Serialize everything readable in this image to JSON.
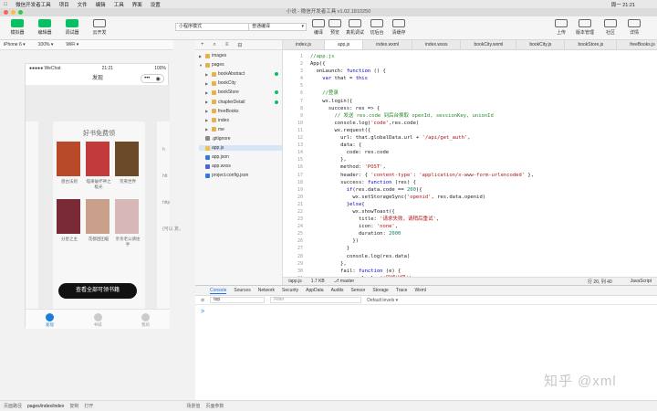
{
  "menubar": {
    "items": [
      "微信开发者工具",
      "项目",
      "文件",
      "编辑",
      "工具",
      "界面",
      "设置"
    ],
    "right": [
      "周一 21:21"
    ]
  },
  "window_title": "小说 - 微信开发者工具 v1.02.1810250",
  "toolbar": {
    "buttons": {
      "simulator": "模拟器",
      "editor": "编辑器",
      "debugger": "调试器",
      "cloud": "云开发",
      "compile": "编译",
      "preview": "预览",
      "remote_debug": "真机调试",
      "background": "切后台",
      "clear_cache": "清缓存",
      "upload": "上传",
      "version": "版本管理",
      "community": "社区",
      "details": "详情"
    },
    "mode_select": "小程序模式",
    "compile_select": "普通编译"
  },
  "simbar": {
    "device": "iPhone 6",
    "zoom": "100%",
    "network": "WiFi"
  },
  "phone": {
    "carrier": "●●●●● WeChat",
    "time": "21:21",
    "battery": "100%",
    "nav_title": "发现",
    "card_title": "好书免费领",
    "books": [
      {
        "name": "盘古法则",
        "color": "#b84a2a"
      },
      {
        "name": "喵果破坏神之极光",
        "color": "#c23a3a"
      },
      {
        "name": "荒夷世界",
        "color": "#6b4a2a"
      },
      {
        "name": "分星之主",
        "color": "#7a2a34"
      },
      {
        "name": "花都团团临",
        "color": "#c9a08a"
      },
      {
        "name": "亲亲老公请往手",
        "color": "#d7b7b7"
      }
    ],
    "cta": "查看全部可领书籍",
    "tabs": [
      "发现",
      "书城",
      "我的"
    ],
    "side_hints": [
      "h",
      "htt",
      "http",
      "(可以 复。"
    ]
  },
  "status": {
    "label": "页面路径",
    "path": "pages/index/index",
    "copy": "复制",
    "open": "打开",
    "scene": "场景值",
    "params": "页面参数"
  },
  "tree": {
    "items": [
      {
        "name": "images",
        "type": "folder",
        "depth": 0,
        "open": false
      },
      {
        "name": "pages",
        "type": "folder",
        "depth": 0,
        "open": true
      },
      {
        "name": "bookAbstract",
        "type": "folder",
        "depth": 1,
        "open": false,
        "dot": true
      },
      {
        "name": "bookCity",
        "type": "folder",
        "depth": 1,
        "open": false
      },
      {
        "name": "bookStore",
        "type": "folder",
        "depth": 1,
        "open": false,
        "dot": true
      },
      {
        "name": "chapterDetail",
        "type": "folder",
        "depth": 1,
        "open": false,
        "dot": true
      },
      {
        "name": "freeBooks",
        "type": "folder",
        "depth": 1,
        "open": false
      },
      {
        "name": "index",
        "type": "folder",
        "depth": 1,
        "open": false
      },
      {
        "name": "me",
        "type": "folder",
        "depth": 1,
        "open": false
      },
      {
        "name": ".gitignore",
        "type": "ign",
        "depth": 0
      },
      {
        "name": "app.js",
        "type": "js",
        "depth": 0,
        "selected": true
      },
      {
        "name": "app.json",
        "type": "json",
        "depth": 0
      },
      {
        "name": "app.wxss",
        "type": "wxss",
        "depth": 0
      },
      {
        "name": "project.config.json",
        "type": "json",
        "depth": 0
      }
    ]
  },
  "editor": {
    "tabs": [
      "index.js",
      "app.js",
      "index.wxml",
      "index.wxss",
      "bookCity.wxml",
      "bookCity.js",
      "bookStore.js",
      "freeBooks.js",
      "ch"
    ],
    "active_tab": 1,
    "lines": [
      "//app.js",
      "App({",
      "  onLaunch: function () {",
      "    var that = this",
      "",
      "    //登录",
      "    wx.login({",
      "      success: res => {",
      "        // 发送 res.code 到后台换取 openId, sessionKey, unionId",
      "        console.log('code',res.code)",
      "        wx.request({",
      "          url: that.globalData.url + '/api/get_auth',",
      "          data: {",
      "            code: res.code",
      "          },",
      "          method: 'POST',",
      "          header: { 'content-type': 'application/x-www-form-urlencoded' },",
      "          success: function (res) {",
      "            if(res.data.code == 200){",
      "              wx.setStorageSync('openid', res.data.openid)",
      "            }else{",
      "              wx.showToast({",
      "                title: '请求失败，请稍后重试',",
      "                icon: 'none',",
      "                duration: 2000",
      "              })",
      "            }",
      "            console.log(res.data)",
      "          },",
      "          fail: function (e) {",
      "            console.log('网络出错');",
      "          }"
    ],
    "status_path": "/app.js",
    "status_size": "1.7 KB",
    "status_branch": "master",
    "status_pos": "行 20, 列 40",
    "status_lang": "JavaScript"
  },
  "console": {
    "tabs": [
      "Console",
      "Sources",
      "Network",
      "Security",
      "AppData",
      "Audits",
      "Sensor",
      "Storage",
      "Trace",
      "Wxml"
    ],
    "context": "top",
    "filter_placeholder": "Filter",
    "levels": "Default levels ▾",
    "prompt": ">"
  },
  "watermark": "知乎 @xml"
}
